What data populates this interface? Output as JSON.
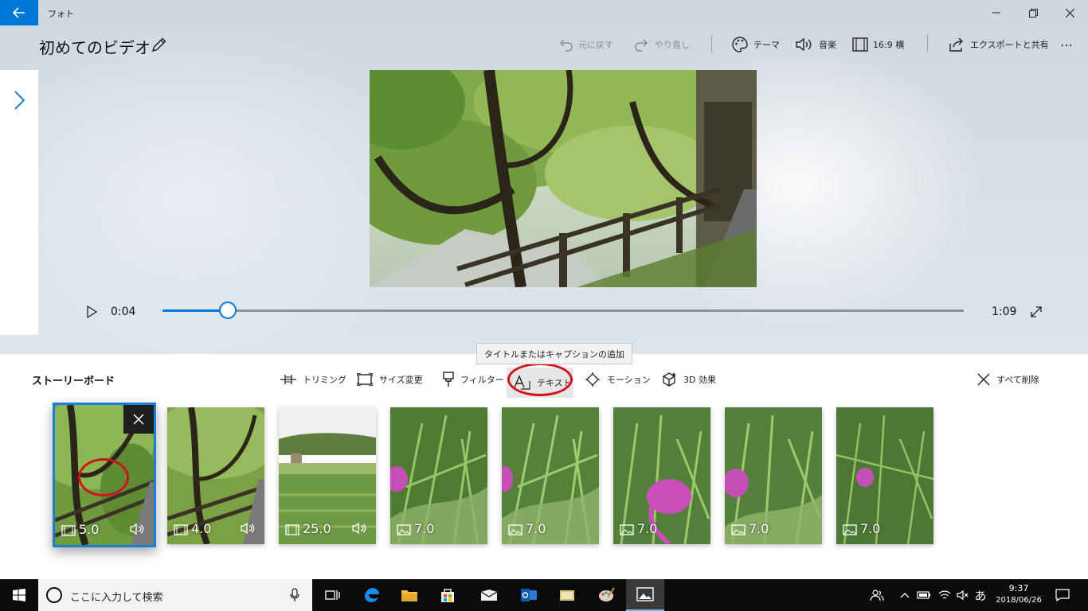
{
  "window": {
    "app_name": "フォト",
    "project_title": "初めてのビデオ"
  },
  "toolbar": {
    "undo_label": "元に戻す",
    "redo_label": "やり直し",
    "theme_label": "テーマ",
    "music_label": "音楽",
    "aspect_label": "16:9 横",
    "export_label": "エクスポートと共有",
    "more_label": "⋯"
  },
  "player": {
    "current_time": "0:04",
    "total_time": "1:09",
    "progress": 0.082
  },
  "storyboard": {
    "title": "ストーリーボード",
    "tools": {
      "trim": "トリミング",
      "resize": "サイズ変更",
      "filter": "フィルター",
      "text": "テキスト",
      "motion": "モーション",
      "effects3d": "3D 効果"
    },
    "tooltip": "タイトルまたはキャプションの追加",
    "remove_all": "すべて削除",
    "clips": [
      {
        "duration": "5.0",
        "type": "video",
        "audio": true,
        "selected": true
      },
      {
        "duration": "4.0",
        "type": "video",
        "audio": true
      },
      {
        "duration": "25.0",
        "type": "video",
        "audio": true
      },
      {
        "duration": "7.0",
        "type": "photo"
      },
      {
        "duration": "7.0",
        "type": "photo"
      },
      {
        "duration": "7.0",
        "type": "photo"
      },
      {
        "duration": "7.0",
        "type": "photo"
      },
      {
        "duration": "7.0",
        "type": "photo"
      }
    ]
  },
  "taskbar": {
    "search_placeholder": "ここに入力して検索",
    "ime_label": "あ",
    "time": "9:37",
    "date": "2018/06/26"
  },
  "colors": {
    "accent": "#0078d7",
    "highlight": "#d0121b"
  }
}
